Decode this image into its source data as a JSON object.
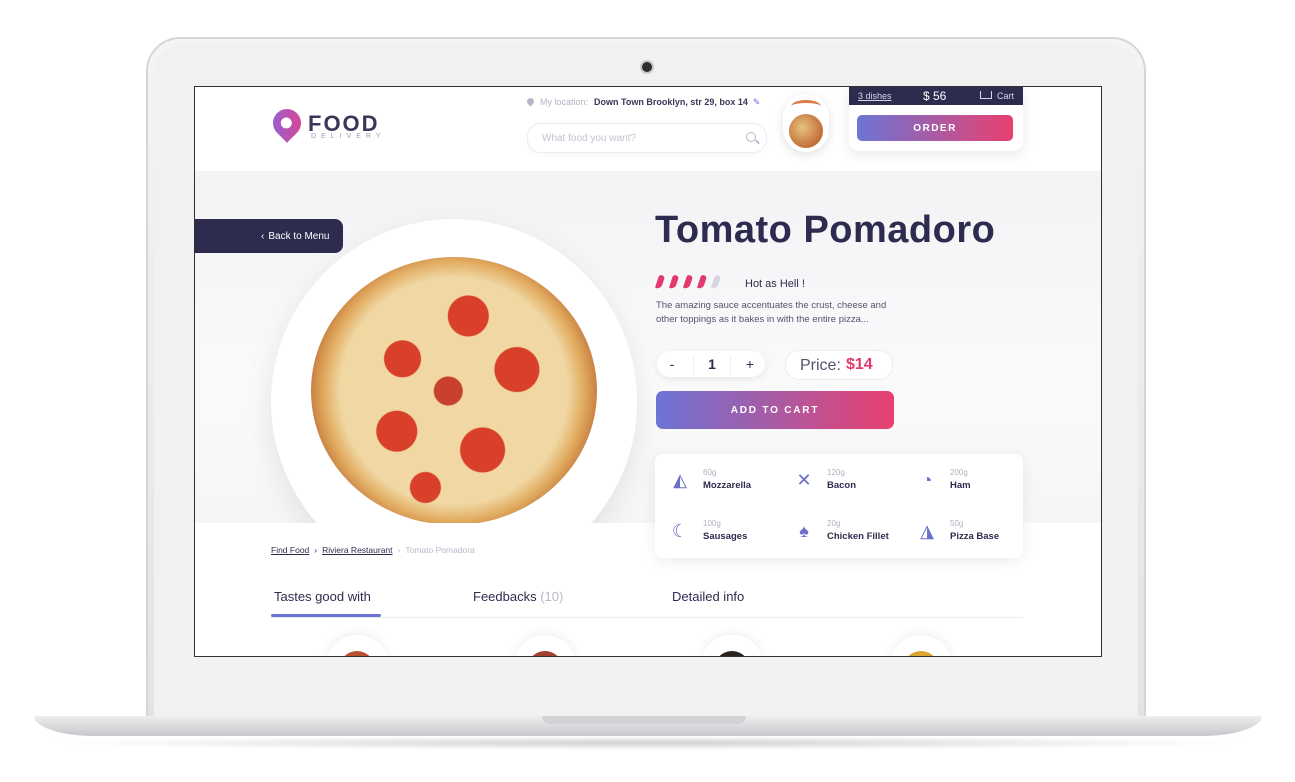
{
  "header": {
    "logo_title": "FOOD",
    "logo_subtitle": "DELIVERY",
    "location_label": "My location:",
    "location_value": "Down Town Brooklyn, str 29, box 14",
    "search_placeholder": "What food you want?"
  },
  "cart": {
    "dishes": "3 dishes",
    "total": "$ 56",
    "cart_label": "Cart",
    "order_label": "ORDER"
  },
  "product": {
    "back_label": "Back to Menu",
    "title": "Tomato Pomadoro",
    "heat_level": 4,
    "heat_max": 5,
    "heat_label": "Hot as Hell !",
    "description": "The amazing sauce accentuates the crust, cheese and other toppings as it bakes in with the entire pizza...",
    "quantity": "1",
    "minus_label": "-",
    "plus_label": "+",
    "price_label": "Price:",
    "price_value": "$14",
    "add_to_cart_label": "ADD TO CART"
  },
  "ingredients": [
    {
      "icon": "cheese-icon",
      "weight": "60g",
      "name": "Mozzarella"
    },
    {
      "icon": "bacon-icon",
      "weight": "120g",
      "name": "Bacon"
    },
    {
      "icon": "ham-icon",
      "weight": "200g",
      "name": "Ham"
    },
    {
      "icon": "sausage-icon",
      "weight": "100g",
      "name": "Sausages"
    },
    {
      "icon": "chicken-leg-icon",
      "weight": "20g",
      "name": "Chicken Fillet"
    },
    {
      "icon": "pizza-slice-icon",
      "weight": "50g",
      "name": "Pizza Base"
    }
  ],
  "breadcrumb": {
    "items": [
      "Find Food",
      "Riviera Restaurant"
    ],
    "current": "Tomato Pomadora"
  },
  "tabs": [
    {
      "label": "Tastes good with",
      "count": ""
    },
    {
      "label": "Feedbacks",
      "count": "(10)"
    },
    {
      "label": "Detailed info",
      "count": ""
    }
  ],
  "colors": {
    "primary_dark": "#2d2c4f",
    "gradient_start": "#6c74d6",
    "gradient_end": "#e9406f",
    "accent_pink": "#e23a6c"
  }
}
